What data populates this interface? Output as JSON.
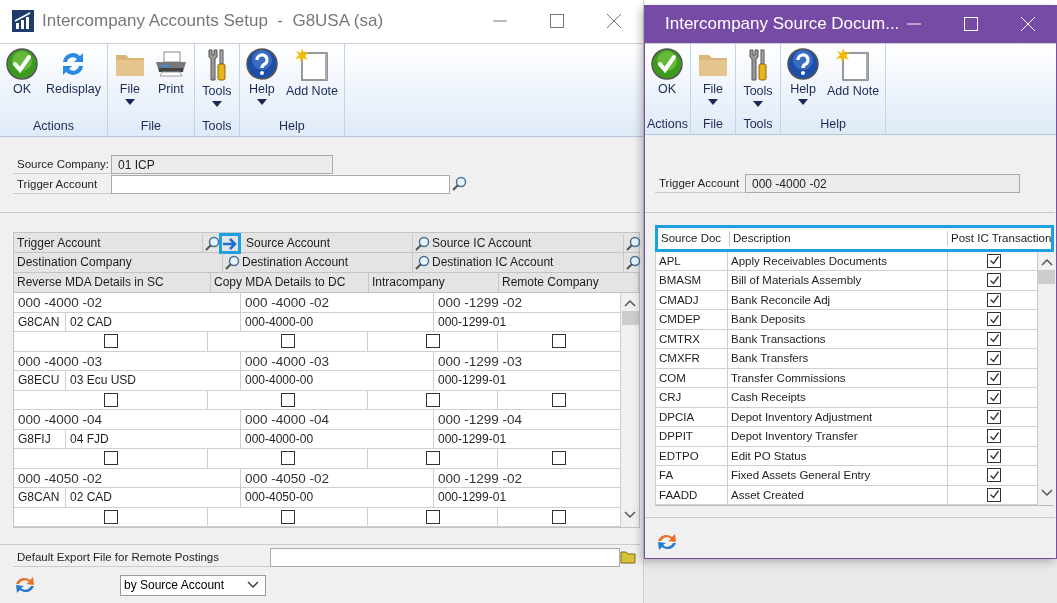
{
  "left_window": {
    "title": "Intercompany Accounts Setup  -  G8USA (sa)",
    "active": false,
    "ribbon": [
      {
        "label": "Actions",
        "buttons": [
          {
            "kind": "ok",
            "label": "OK",
            "dropdown": false
          },
          {
            "kind": "redisplay",
            "label": "Redisplay",
            "dropdown": false
          }
        ]
      },
      {
        "label": "File",
        "buttons": [
          {
            "kind": "folder",
            "label": "File",
            "dropdown": true
          },
          {
            "kind": "print",
            "label": "Print",
            "dropdown": false
          }
        ]
      },
      {
        "label": "Tools",
        "buttons": [
          {
            "kind": "tools",
            "label": "Tools",
            "dropdown": true
          }
        ]
      },
      {
        "label": "Help",
        "buttons": [
          {
            "kind": "help",
            "label": "Help",
            "dropdown": true
          },
          {
            "kind": "note",
            "label": "Add Note",
            "dropdown": false
          }
        ]
      }
    ],
    "source_company": {
      "label": "Source Company:",
      "value": "01 ICP"
    },
    "trigger_account": {
      "label": "Trigger Account"
    },
    "grid": {
      "arrow_highlighted": true,
      "headers": {
        "trigger_account": "Trigger Account",
        "source_account": "Source Account",
        "source_ic_account": "Source IC Account",
        "destination_company": "Destination Company",
        "destination_account": "Destination Account",
        "destination_ic_account": "Destination IC Account",
        "reverse_mda": "Reverse MDA Details in SC",
        "copy_mda": "Copy MDA Details to DC",
        "intracompany": "Intracompany",
        "remote_company": "Remote Company"
      },
      "records": [
        {
          "trigger_account": "000 -4000 -02",
          "source_account": "000 -4000 -02",
          "source_ic_account": "000 -1299 -02",
          "destination_company": "G8CAN",
          "destination_company_name": "02 CAD",
          "destination_account": "000-4000-00",
          "destination_ic_account": "000-1299-01",
          "reverse_mda": false,
          "copy_mda": false,
          "intracompany": false,
          "remote_company": false
        },
        {
          "trigger_account": "000 -4000 -03",
          "source_account": "000 -4000 -03",
          "source_ic_account": "000 -1299 -03",
          "destination_company": "G8ECU",
          "destination_company_name": "03 Ecu USD",
          "destination_account": "000-4000-00",
          "destination_ic_account": "000-1299-01",
          "reverse_mda": false,
          "copy_mda": false,
          "intracompany": false,
          "remote_company": false
        },
        {
          "trigger_account": "000 -4000 -04",
          "source_account": "000 -4000 -04",
          "source_ic_account": "000 -1299 -04",
          "destination_company": "G8FIJ",
          "destination_company_name": "04 FJD",
          "destination_account": "000-4000-00",
          "destination_ic_account": "000-1299-01",
          "reverse_mda": false,
          "copy_mda": false,
          "intracompany": false,
          "remote_company": false
        },
        {
          "trigger_account": "000 -4050 -02",
          "source_account": "000 -4050 -02",
          "source_ic_account": "000 -1299 -02",
          "destination_company": "G8CAN",
          "destination_company_name": "02 CAD",
          "destination_account": "000-4050-00",
          "destination_ic_account": "000-1299-01",
          "reverse_mda": false,
          "copy_mda": false,
          "intracompany": false,
          "remote_company": false
        }
      ]
    },
    "export_file": {
      "label": "Default Export File for Remote Postings"
    },
    "sort_by": {
      "value": "by Source Account"
    }
  },
  "right_window": {
    "title": "Intercompany Source Docum...",
    "active": true,
    "ribbon": [
      {
        "label": "Actions",
        "buttons": [
          {
            "kind": "ok",
            "label": "OK",
            "dropdown": false
          }
        ]
      },
      {
        "label": "File",
        "buttons": [
          {
            "kind": "folder",
            "label": "File",
            "dropdown": true
          }
        ]
      },
      {
        "label": "Tools",
        "buttons": [
          {
            "kind": "tools",
            "label": "Tools",
            "dropdown": true
          }
        ]
      },
      {
        "label": "Help",
        "buttons": [
          {
            "kind": "help",
            "label": "Help",
            "dropdown": true
          },
          {
            "kind": "note",
            "label": "Add Note",
            "dropdown": false
          }
        ]
      }
    ],
    "trigger_account": {
      "label": "Trigger Account",
      "value": "000 -4000 -02"
    },
    "table": {
      "header_highlighted": true,
      "columns": [
        "Source Doc",
        "Description",
        "Post IC Transaction"
      ],
      "rows": [
        {
          "source_doc": "APL",
          "description": "Apply Receivables Documents",
          "post_ic": true
        },
        {
          "source_doc": "BMASM",
          "description": "Bill of Materials Assembly",
          "post_ic": true
        },
        {
          "source_doc": "CMADJ",
          "description": "Bank Reconcile Adj",
          "post_ic": true
        },
        {
          "source_doc": "CMDEP",
          "description": "Bank Deposits",
          "post_ic": true
        },
        {
          "source_doc": "CMTRX",
          "description": "Bank Transactions",
          "post_ic": true
        },
        {
          "source_doc": "CMXFR",
          "description": "Bank Transfers",
          "post_ic": true
        },
        {
          "source_doc": "COM",
          "description": "Transfer Commissions",
          "post_ic": true
        },
        {
          "source_doc": "CRJ",
          "description": "Cash Receipts",
          "post_ic": true
        },
        {
          "source_doc": "DPCIA",
          "description": "Depot Inventory Adjustment",
          "post_ic": true
        },
        {
          "source_doc": "DPPIT",
          "description": "Depot Inventory Transfer",
          "post_ic": true
        },
        {
          "source_doc": "EDTPO",
          "description": "Edit PO Status",
          "post_ic": true
        },
        {
          "source_doc": "FA",
          "description": "Fixed Assets General Entry",
          "post_ic": true
        },
        {
          "source_doc": "FAADD",
          "description": "Asset Created",
          "post_ic": true
        }
      ]
    }
  }
}
